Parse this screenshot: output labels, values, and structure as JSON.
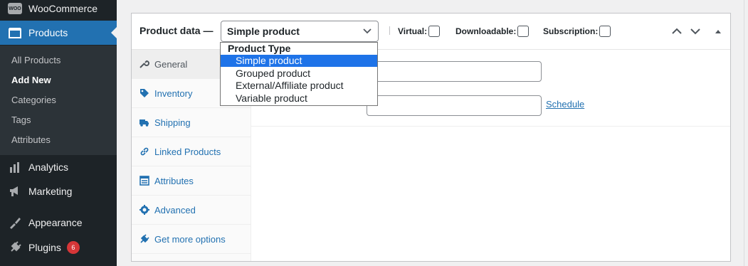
{
  "admin_menu": {
    "woocommerce_label": "WooCommerce",
    "woo_logo_text": "WOO",
    "products_label": "Products",
    "submenu": [
      "All Products",
      "Add New",
      "Categories",
      "Tags",
      "Attributes"
    ],
    "analytics_label": "Analytics",
    "marketing_label": "Marketing",
    "appearance_label": "Appearance",
    "plugins_label": "Plugins",
    "plugins_badge": "6"
  },
  "product_data": {
    "title": "Product data —",
    "selected_type": "Simple product",
    "virtual_label": "Virtual:",
    "downloadable_label": "Downloadable:",
    "subscription_label": "Subscription:"
  },
  "dropdown": {
    "group_label": "Product Type",
    "options": [
      "Simple product",
      "Grouped product",
      "External/Affiliate product",
      "Variable product"
    ],
    "selected_index": 0
  },
  "tabs": [
    "General",
    "Inventory",
    "Shipping",
    "Linked Products",
    "Attributes",
    "Advanced",
    "Get more options"
  ],
  "panel": {
    "schedule_link": "Schedule"
  },
  "colors": {
    "menu_bg": "#1d2327",
    "menu_current": "#2271b1",
    "link_blue": "#2271b1",
    "selected_option": "#1e73e8",
    "badge_red": "#d63638"
  }
}
